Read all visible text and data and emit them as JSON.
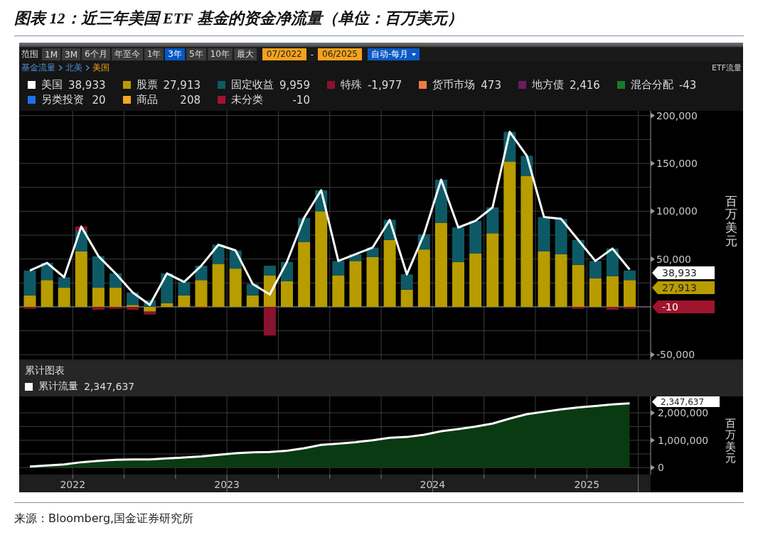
{
  "title": "图表 12：近三年美国 ETF 基金的资金净流量（单位：百万美元）",
  "terminal": {
    "toolbar": {
      "range_label": "范围",
      "range_buttons": [
        {
          "label": "1M",
          "selected": false
        },
        {
          "label": "3M",
          "selected": false
        },
        {
          "label": "6个月",
          "selected": false
        },
        {
          "label": "年至今",
          "selected": false
        },
        {
          "label": "1年",
          "selected": false
        },
        {
          "label": "3年",
          "selected": true
        },
        {
          "label": "5年",
          "selected": false
        },
        {
          "label": "10年",
          "selected": false
        },
        {
          "label": "最大",
          "selected": false
        }
      ],
      "start_date": "07/2022",
      "date_separator": "-",
      "end_date": "06/2025",
      "frequency": "自动-每月"
    },
    "breadcrumb": [
      {
        "label": "基金流量",
        "selected": false
      },
      {
        "label": "北美",
        "selected": false
      },
      {
        "label": "美国",
        "selected": true
      }
    ],
    "panel_label": "ETF流量",
    "legend": [
      {
        "name": "美国",
        "value": "38,933",
        "color": "#ffffff"
      },
      {
        "name": "股票",
        "value": "27,913",
        "color": "#b89c00"
      },
      {
        "name": "固定收益",
        "value": "9,959",
        "color": "#0d5a66"
      },
      {
        "name": "特殊",
        "value": "-1,977",
        "color": "#8a1230"
      },
      {
        "name": "货币市场",
        "value": "473",
        "color": "#f07b3f"
      },
      {
        "name": "地方债",
        "value": "2,416",
        "color": "#6b1a5e"
      },
      {
        "name": "混合分配",
        "value": "-43",
        "color": "#1a7a2a"
      },
      {
        "name": "另类投资",
        "value": "20",
        "color": "#1b73e8"
      },
      {
        "name": "商品",
        "value": "208",
        "color": "#f5a623"
      },
      {
        "name": "未分类",
        "value": "-10",
        "color": "#a0142e"
      }
    ],
    "main_chart": {
      "chart_data": {
        "type": "bar",
        "stacked": true,
        "grid": true,
        "ylabel": "百万美元",
        "ylim": [
          -55000,
          205000
        ],
        "yticks": [
          {
            "value": 200000,
            "label": "200,000"
          },
          {
            "value": 150000,
            "label": "150,000"
          },
          {
            "value": 100000,
            "label": "100,000"
          },
          {
            "value": 50000,
            "label": "50,000"
          },
          {
            "value": -50000,
            "label": "-50,000"
          }
        ],
        "series": [
          {
            "type": "bar",
            "color": "#b89c00",
            "values": [
              12000,
              28000,
              20000,
              58000,
              20000,
              20000,
              2000,
              -5000,
              4000,
              12000,
              28000,
              45000,
              40000,
              12000,
              33000,
              27000,
              68000,
              100000,
              33000,
              48000,
              52000,
              70000,
              18000,
              60000,
              88000,
              47000,
              56000,
              77000,
              152000,
              137000,
              58000,
              55000,
              44000,
              30000,
              32000,
              28000
            ]
          },
          {
            "type": "bar",
            "color": "#0d5a66",
            "values": [
              26000,
              18000,
              11000,
              22000,
              33000,
              15000,
              13000,
              7000,
              31000,
              14000,
              15000,
              20000,
              19000,
              12000,
              10000,
              20000,
              25000,
              22000,
              15000,
              7000,
              10000,
              21000,
              16000,
              16000,
              45000,
              36000,
              34000,
              27000,
              31000,
              21000,
              36000,
              37000,
              26000,
              18000,
              29000,
              10000
            ]
          },
          {
            "type": "bar",
            "color": "#8a1230",
            "values": [
              -2000,
              0,
              0,
              4000,
              -3000,
              -2000,
              -3000,
              -3000,
              0,
              0,
              -1000,
              0,
              0,
              0,
              -30000,
              0,
              0,
              0,
              0,
              0,
              0,
              0,
              0,
              0,
              0,
              0,
              0,
              0,
              0,
              0,
              0,
              0,
              -2000,
              0,
              -3000,
              -2000
            ]
          },
          {
            "type": "line",
            "color": "#ffffff",
            "values": [
              38000,
              46000,
              31000,
              84000,
              53000,
              35000,
              15000,
              2000,
              35000,
              26000,
              43000,
              65000,
              59000,
              24000,
              13000,
              47000,
              93000,
              122000,
              48000,
              55000,
              62000,
              91000,
              34000,
              76000,
              133000,
              83000,
              90000,
              104000,
              183000,
              158000,
              94000,
              92000,
              70000,
              48000,
              61000,
              39000
            ]
          }
        ]
      },
      "value_tags": [
        {
          "text": "38,933",
          "color": "#ffffff"
        },
        {
          "text": "27,913",
          "color": "#b89c00"
        },
        {
          "text": "-10",
          "color": "#a0142e"
        }
      ]
    },
    "cumulative": {
      "title": "累计图表",
      "legend": {
        "name": "累计流量",
        "value": "2,347,637",
        "color": "#ffffff"
      },
      "chart_data": {
        "type": "area",
        "grid": true,
        "ylabel": "百万美元",
        "ylim": [
          -250000,
          2600000
        ],
        "yticks": [
          {
            "value": 2000000,
            "label": "2,000,000"
          },
          {
            "value": 1000000,
            "label": "1,000,000"
          },
          {
            "value": 0,
            "label": "0"
          }
        ],
        "series": [
          {
            "color": "#0a3a12",
            "values": [
              40000,
              80000,
              120000,
              200000,
              250000,
              290000,
              300000,
              300000,
              340000,
              370000,
              410000,
              470000,
              530000,
              560000,
              570000,
              620000,
              710000,
              830000,
              880000,
              930000,
              1000000,
              1090000,
              1120000,
              1200000,
              1330000,
              1410000,
              1500000,
              1610000,
              1790000,
              1950000,
              2040000,
              2130000,
              2200000,
              2250000,
              2310000,
              2350000
            ]
          }
        ]
      },
      "year_labels": [
        "2022",
        "2023",
        "2024",
        "2025"
      ],
      "value_tag": "2,347,637"
    }
  },
  "source": "来源：Bloomberg,国金证券研究所"
}
